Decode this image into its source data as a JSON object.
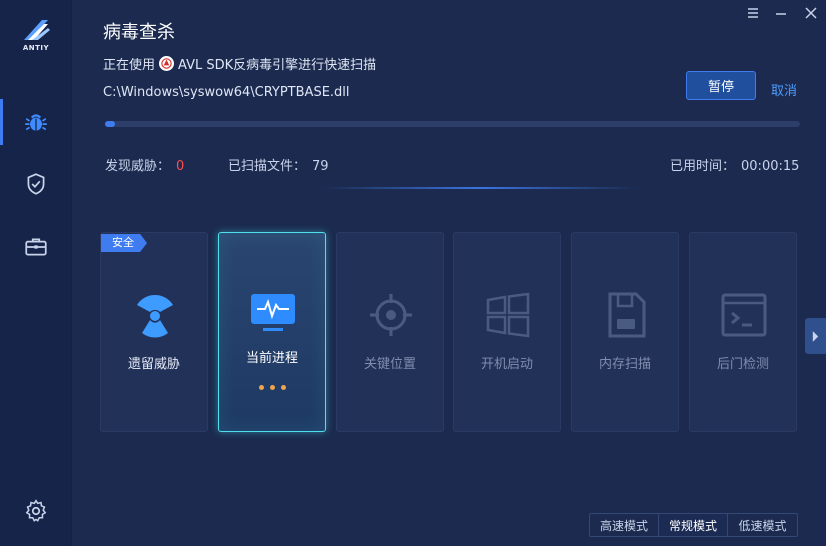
{
  "app": {
    "logo_text": "ANTIY",
    "title": "病毒查杀"
  },
  "sidebar": {
    "items": [
      {
        "name": "virus-scan",
        "icon": "bug-icon",
        "active": true
      },
      {
        "name": "protection",
        "icon": "shield-check-icon",
        "active": false
      },
      {
        "name": "toolbox",
        "icon": "toolbox-icon",
        "active": false
      }
    ],
    "settings_icon": "gear-icon"
  },
  "window_controls": [
    "menu-icon",
    "minimize-icon",
    "close-icon"
  ],
  "scan": {
    "engine_prefix": "正在使用",
    "engine_text": "AVL SDK反病毒引擎进行快速扫描",
    "current_file": "C:\\Windows\\syswow64\\CRYPTBASE.dll",
    "progress": 0.015,
    "pause_label": "暂停",
    "cancel_label": "取消"
  },
  "stats": {
    "threats_label": "发现威胁：",
    "threats_value": "0",
    "scanned_label": "已扫描文件：",
    "scanned_value": "79",
    "elapsed_label": "已用时间：",
    "elapsed_value": "00:00:15"
  },
  "cards": [
    {
      "label": "遗留威胁",
      "icon": "radiation-icon",
      "badge": "安全",
      "state": "done"
    },
    {
      "label": "当前进程",
      "icon": "monitor-pulse-icon",
      "state": "active"
    },
    {
      "label": "关键位置",
      "icon": "crosshair-icon",
      "state": "pending"
    },
    {
      "label": "开机启动",
      "icon": "windows-icon",
      "state": "pending"
    },
    {
      "label": "内存扫描",
      "icon": "floppy-icon",
      "state": "pending"
    },
    {
      "label": "后门检测",
      "icon": "terminal-icon",
      "state": "pending"
    }
  ],
  "modes": {
    "items": [
      "高速模式",
      "常规模式",
      "低速模式"
    ],
    "selected": "常规模式"
  },
  "colors": {
    "accent": "#3e7cf0",
    "active_border": "#4fe0ee",
    "threat_zero": "#ff4c4c",
    "progress_dot": "#f1a54a"
  }
}
